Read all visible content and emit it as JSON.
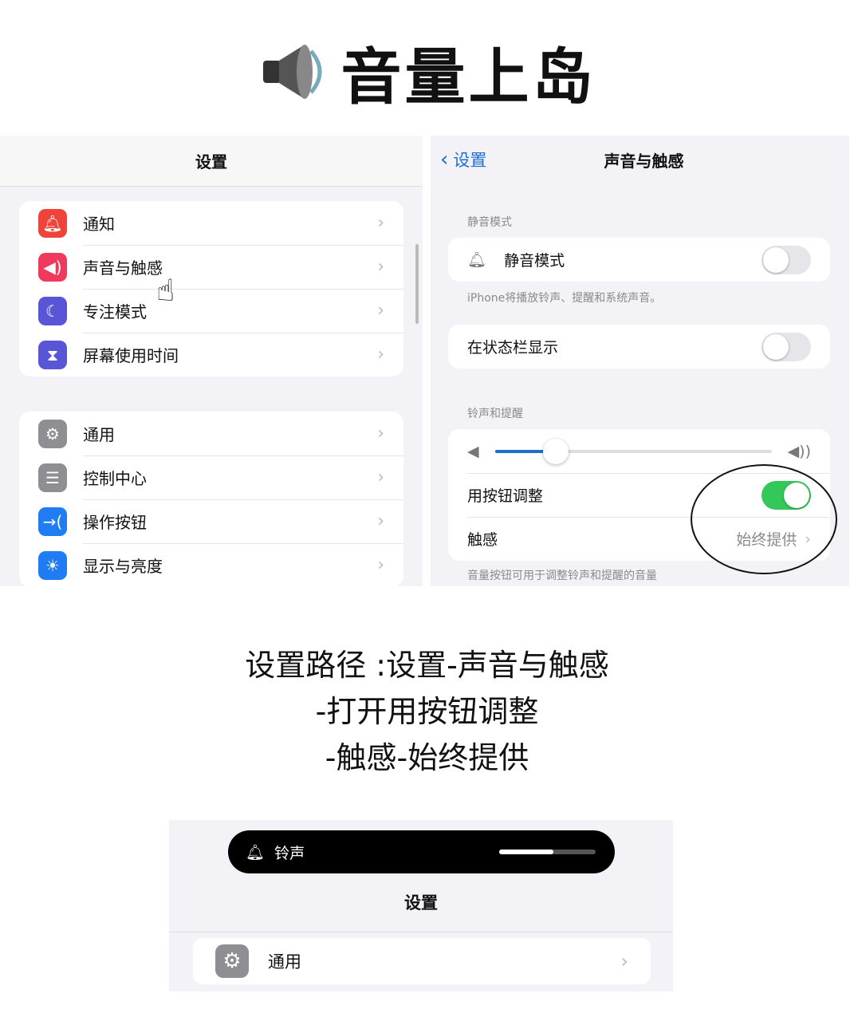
{
  "title": {
    "text": "音量上岛",
    "icon": "speaker-icon"
  },
  "left": {
    "nav_title": "设置",
    "group1": [
      {
        "label": "通知",
        "icon": "bell-badge-icon",
        "color": "#f0443a"
      },
      {
        "label": "声音与触感",
        "icon": "speaker-wave-icon",
        "color": "#ef3a5d"
      },
      {
        "label": "专注模式",
        "icon": "moon-icon",
        "color": "#5856d6"
      },
      {
        "label": "屏幕使用时间",
        "icon": "hourglass-icon",
        "color": "#5856d6"
      }
    ],
    "group2": [
      {
        "label": "通用",
        "icon": "gear-icon",
        "color": "#8e8e93"
      },
      {
        "label": "控制中心",
        "icon": "switches-icon",
        "color": "#8e8e93"
      },
      {
        "label": "操作按钮",
        "icon": "action-button-icon",
        "color": "#1f7cf2"
      },
      {
        "label": "显示与亮度",
        "icon": "sun-icon",
        "color": "#1f7cf2"
      }
    ]
  },
  "right": {
    "back_label": "设置",
    "nav_title": "声音与触感",
    "silent_section": "静音模式",
    "silent_label": "静音模式",
    "silent_on": false,
    "silent_footer": "iPhone将播放铃声、提醒和系统声音。",
    "statusbar_label": "在状态栏显示",
    "statusbar_on": false,
    "ring_section": "铃声和提醒",
    "volume_fraction": 0.22,
    "buttons_label": "用按钮调整",
    "buttons_on": true,
    "haptics_label": "触感",
    "haptics_value": "始终提供",
    "ring_footer": "音量按钮可用于调整铃声和提醒的音量",
    "accent": "#1f6fd1",
    "toggle_on": "#34c759"
  },
  "hint": [
    "设置路径 :设置-声音与触感",
    "-打开用按钮调整",
    "-触感-始终提供"
  ],
  "bottom": {
    "island_label": "铃声",
    "island_level": 0.56,
    "nav_title": "设置",
    "row_label": "通用"
  }
}
